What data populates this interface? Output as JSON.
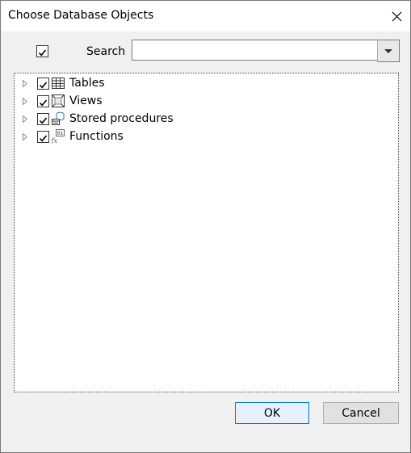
{
  "window": {
    "title": "Choose Database Objects"
  },
  "search": {
    "label": "Search",
    "value": "",
    "select_all_checked": true
  },
  "tree": {
    "items": [
      {
        "label": "Tables",
        "icon": "table-icon",
        "checked": true,
        "expanded": false
      },
      {
        "label": "Views",
        "icon": "view-icon",
        "checked": true,
        "expanded": false
      },
      {
        "label": "Stored procedures",
        "icon": "stored-procedure-icon",
        "checked": true,
        "expanded": false
      },
      {
        "label": "Functions",
        "icon": "function-icon",
        "checked": true,
        "expanded": false
      }
    ]
  },
  "buttons": {
    "ok": "OK",
    "cancel": "Cancel"
  },
  "colors": {
    "accent": "#0078d7",
    "background": "#f0f0f0"
  }
}
